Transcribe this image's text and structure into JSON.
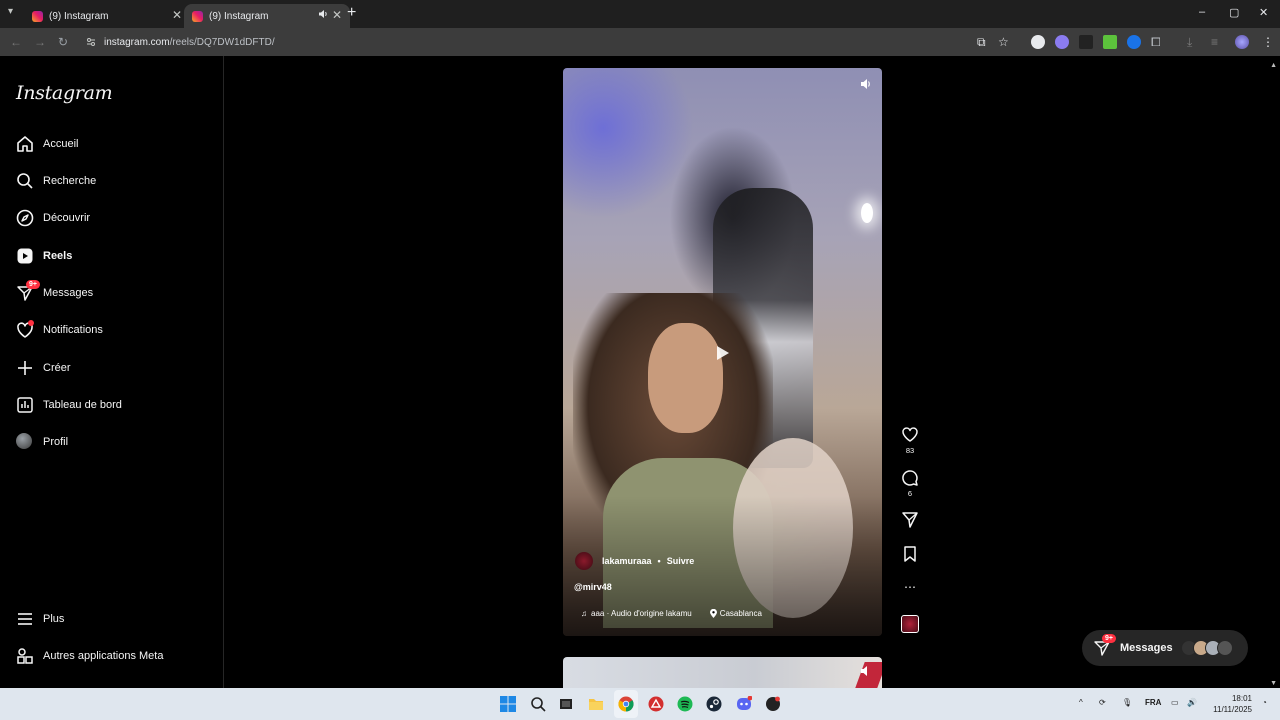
{
  "browser": {
    "tabs": [
      {
        "title": "(9) Instagram",
        "active": false
      },
      {
        "title": "(9) Instagram",
        "active": true,
        "muted_icon": "speaker-icon"
      }
    ],
    "new_tab_symbol": "+",
    "url_host": "instagram.com",
    "url_path": "/reels/DQ7DW1dDFTD/",
    "window_controls": {
      "minimize": "–",
      "restore": "▢",
      "close": "✕"
    }
  },
  "sidebar": {
    "logo": "Instagram",
    "items": [
      {
        "label": "Accueil",
        "icon": "home-icon"
      },
      {
        "label": "Recherche",
        "icon": "search-icon"
      },
      {
        "label": "Découvrir",
        "icon": "compass-icon"
      },
      {
        "label": "Reels",
        "icon": "reels-icon"
      },
      {
        "label": "Messages",
        "icon": "messenger-icon",
        "badge": "9+"
      },
      {
        "label": "Notifications",
        "icon": "heart-icon"
      },
      {
        "label": "Créer",
        "icon": "plus-icon"
      },
      {
        "label": "Tableau de bord",
        "icon": "dashboard-icon"
      },
      {
        "label": "Profil",
        "icon": "avatar"
      }
    ],
    "bottom_items": [
      {
        "label": "Plus",
        "icon": "menu-icon"
      },
      {
        "label": "Autres applications Meta",
        "icon": "meta-apps-icon"
      }
    ]
  },
  "reel": {
    "username": "lakamuraaa",
    "dot": "•",
    "follow_label": "Suivre",
    "caption": "@mirv48",
    "audio": "aaa · Audio d'origine  lakamu",
    "location": "Casablanca",
    "likes": "83",
    "comments": "6"
  },
  "messages_pill": {
    "label": "Messages",
    "badge": "9+"
  },
  "taskbar": {
    "language": "FRA",
    "time": "18:01",
    "date": "11/11/2025",
    "tray_up_symbol": "^"
  }
}
